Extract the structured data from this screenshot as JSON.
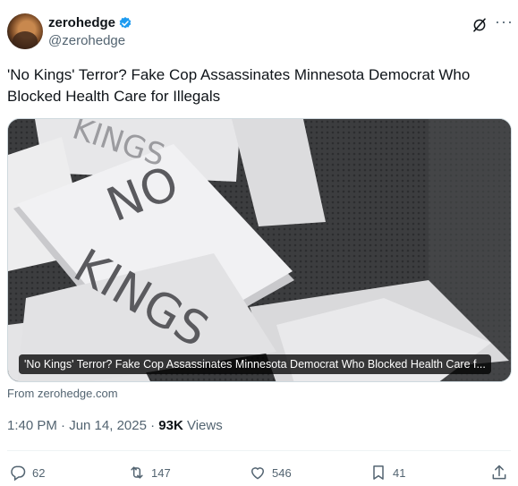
{
  "author": {
    "display_name": "zerohedge",
    "handle": "@zerohedge"
  },
  "tweet": {
    "text": "'No Kings' Terror? Fake Cop Assassinates Minnesota Democrat Who Blocked Health Care for Illegals"
  },
  "card": {
    "image_text_1": "NO",
    "image_text_2": "KINGS",
    "caption": "'No Kings' Terror? Fake Cop Assassinates Minnesota Democrat Who Blocked Health Care f..."
  },
  "source": "From zerohedge.com",
  "meta": {
    "timestamp": "1:40 PM · Jun 14, 2025 · ",
    "views_count": "93K",
    "views_label": " Views"
  },
  "actions": {
    "replies": "62",
    "reposts": "147",
    "likes": "546",
    "bookmarks": "41"
  },
  "colors": {
    "text": "#0f1419",
    "secondary": "#536471",
    "verified": "#1d9bf0"
  }
}
